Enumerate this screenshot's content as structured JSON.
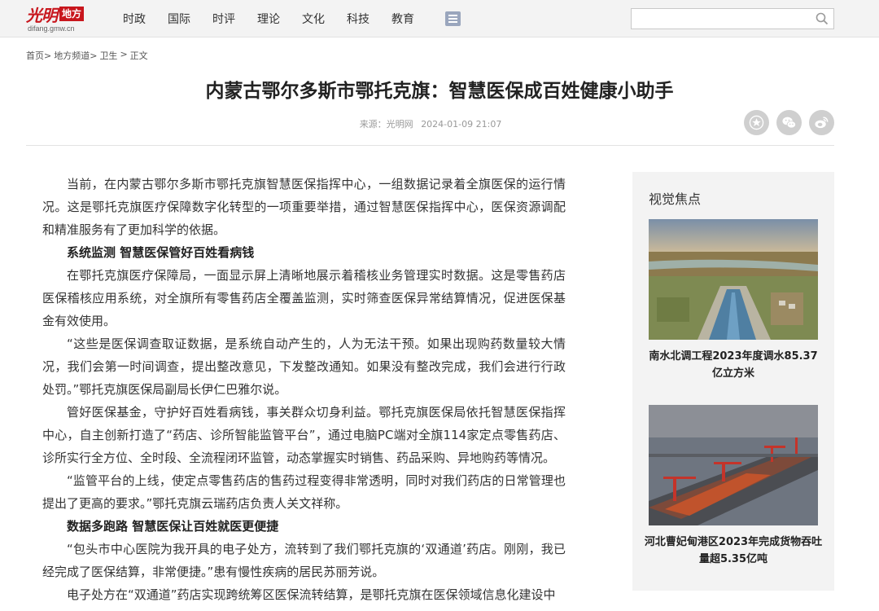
{
  "site": {
    "logo_script": "光明",
    "logo_box": "地方",
    "logo_domain": "difang.gmw.cn"
  },
  "nav": {
    "items": [
      "时政",
      "国际",
      "时评",
      "理论",
      "文化",
      "科技",
      "教育"
    ]
  },
  "search": {
    "placeholder": "",
    "value": ""
  },
  "breadcrumb": [
    "首页>",
    "地方频道>",
    "卫生",
    ">",
    "正文"
  ],
  "article": {
    "title": "内蒙古鄂尔多斯市鄂托克旗：智慧医保成百姓健康小助手",
    "source": "来源：光明网",
    "date": "2024-01-09 21:07",
    "paragraphs": [
      {
        "type": "text",
        "text": "当前，在内蒙古鄂尔多斯市鄂托克旗智慧医保指挥中心，一组数据记录着全旗医保的运行情况。这是鄂托克旗医疗保障数字化转型的一项重要举措，通过智慧医保指挥中心，医保资源调配和精准服务有了更加科学的依据。"
      },
      {
        "type": "sub",
        "text": "系统监测 智慧医保管好百姓看病钱"
      },
      {
        "type": "text",
        "text": "在鄂托克旗医疗保障局，一面显示屏上清晰地展示着稽核业务管理实时数据。这是零售药店医保稽核应用系统，对全旗所有零售药店全覆盖监测，实时筛查医保异常结算情况，促进医保基金有效使用。"
      },
      {
        "type": "text",
        "text": "“这些是医保调查取证数据，是系统自动产生的，人为无法干预。如果出现购药数量较大情况，我们会第一时间调查，提出整改意见，下发整改通知。如果没有整改完成，我们会进行行政处罚。”鄂托克旗医保局副局长伊仁巴雅尔说。"
      },
      {
        "type": "text",
        "text": "管好医保基金，守护好百姓看病钱，事关群众切身利益。鄂托克旗医保局依托智慧医保指挥中心，自主创新打造了“药店、诊所智能监管平台”，通过电脑PC端对全旗114家定点零售药店、诊所实行全方位、全时段、全流程闭环监管，动态掌握实时销售、药品采购、异地购药等情况。"
      },
      {
        "type": "text",
        "text": "“监管平台的上线，使定点零售药店的售药过程变得非常透明，同时对我们药店的日常管理也提出了更高的要求。”鄂托克旗云瑞药店负责人关文祥称。"
      },
      {
        "type": "sub",
        "text": "数据多跑路 智慧医保让百姓就医更便捷"
      },
      {
        "type": "text",
        "text": "“包头市中心医院为我开具的电子处方，流转到了我们鄂托克旗的‘双通道’药店。刚刚，我已经完成了医保结算，非常便捷。”患有慢性疾病的居民苏丽芳说。"
      },
      {
        "type": "text",
        "text": "电子处方在“双通道”药店实现跨统筹区医保流转结算，是鄂托克旗在医保领域信息化建设中"
      }
    ]
  },
  "sidebar": {
    "title": "视觉焦点",
    "items": [
      {
        "caption": "南水北调工程2023年度调水85.37亿立方米"
      },
      {
        "caption": "河北曹妃甸港区2023年完成货物吞吐量超5.35亿吨"
      }
    ]
  },
  "colors": {
    "brand_red": "#c8161d",
    "nav_bg": "#f3f3f3",
    "share_grey": "#cfcfcf"
  }
}
